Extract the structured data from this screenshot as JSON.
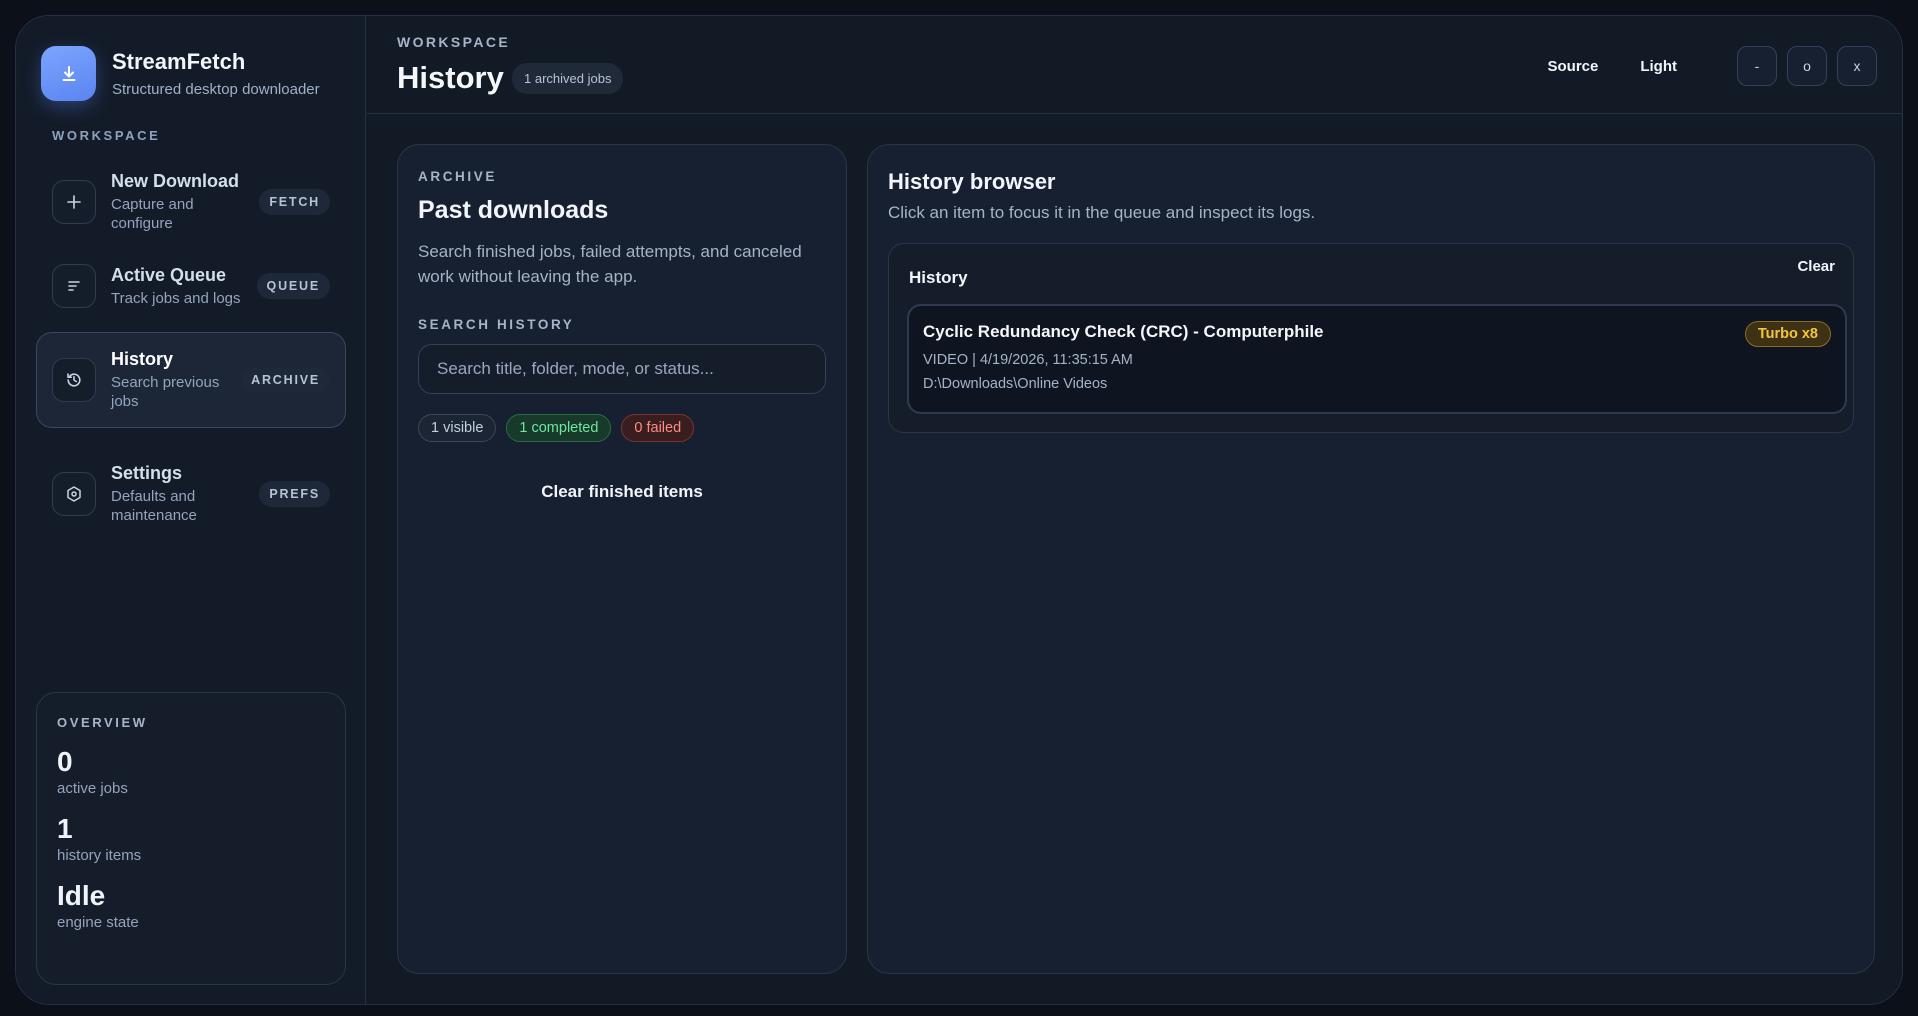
{
  "brand": {
    "name": "StreamFetch",
    "subtitle": "Structured desktop downloader",
    "icon": "download-icon",
    "accent": "#6e97fb"
  },
  "sidebar": {
    "section_label": "WORKSPACE",
    "items": [
      {
        "title": "New Download",
        "subtitle": "Capture and configure",
        "badge": "FETCH",
        "icon": "plus-icon"
      },
      {
        "title": "Active Queue",
        "subtitle": "Track jobs and logs",
        "badge": "QUEUE",
        "icon": "list-icon"
      },
      {
        "title": "History",
        "subtitle": "Search previous jobs",
        "badge": "ARCHIVE",
        "icon": "history-icon",
        "active": true
      },
      {
        "title": "Settings",
        "subtitle": "Defaults and maintenance",
        "badge": "PREFS",
        "icon": "settings-icon"
      }
    ]
  },
  "overview": {
    "label": "OVERVIEW",
    "stats": [
      {
        "value": "0",
        "label": "active jobs"
      },
      {
        "value": "1",
        "label": "history items"
      },
      {
        "value": "Idle",
        "label": "engine state"
      }
    ]
  },
  "header": {
    "eyebrow": "WORKSPACE",
    "title": "History",
    "pill": "1 archived jobs",
    "source": "Source",
    "theme": "Light",
    "minimize": "-",
    "maximize": "o",
    "close": "x"
  },
  "archive": {
    "eyebrow": "ARCHIVE",
    "title": "Past downloads",
    "description": "Search finished jobs, failed attempts, and canceled work without leaving the app.",
    "search_label": "SEARCH HISTORY",
    "search_placeholder": "Search title, folder, mode, or status...",
    "search_value": "",
    "chips": {
      "visible": "1 visible",
      "completed": "1 completed",
      "failed": "0 failed"
    },
    "clear_finished": "Clear finished items"
  },
  "browser": {
    "title": "History browser",
    "description": "Click an item to focus it in the queue and inspect its logs.",
    "box_title": "History",
    "clear": "Clear",
    "items": [
      {
        "title": "Cyclic Redundancy Check (CRC) - Computerphile",
        "meta": "VIDEO | 4/19/2026, 11:35:15 AM",
        "path": "D:\\Downloads\\Online Videos",
        "badge": "Turbo x8"
      }
    ]
  },
  "colors": {
    "completed": "#6ee7a0",
    "failed": "#ff8c84",
    "turbo": "#f5c542"
  }
}
